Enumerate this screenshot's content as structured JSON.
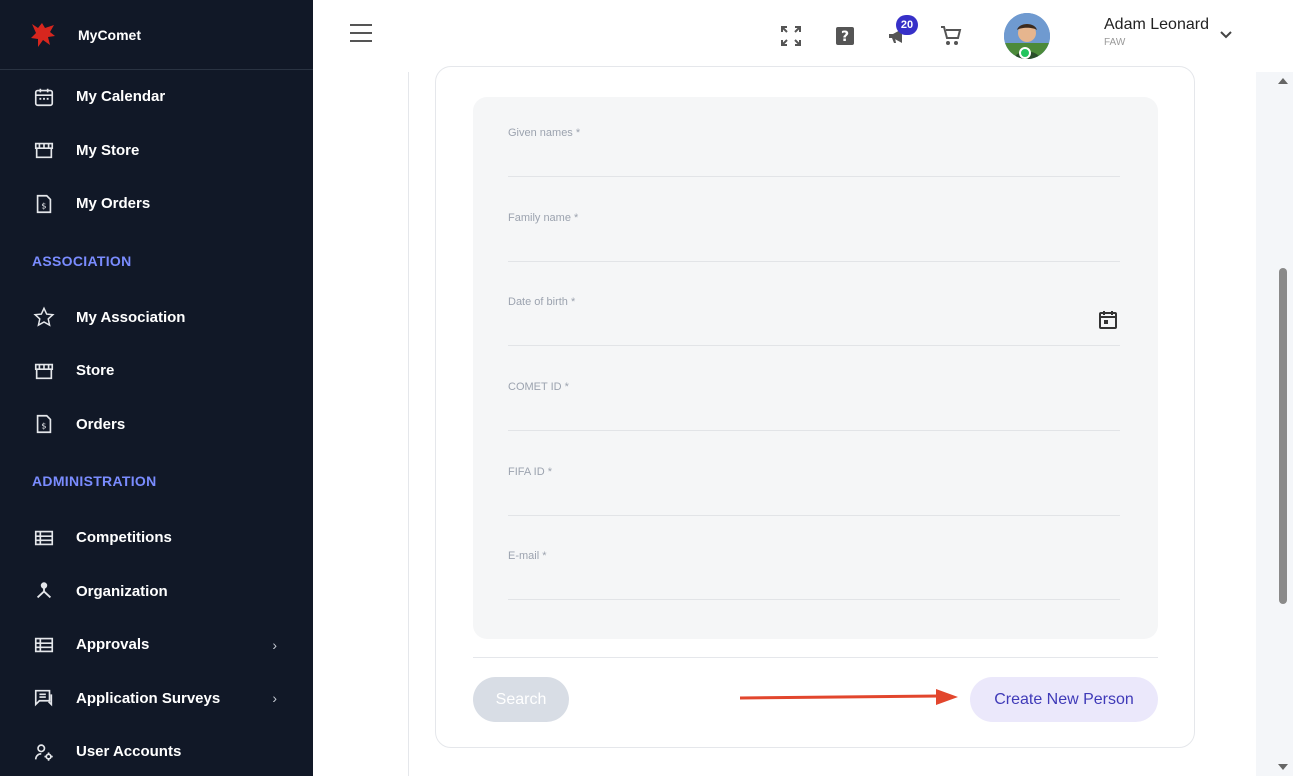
{
  "brand": {
    "name": "MyComet",
    "color": "#d7261e"
  },
  "sidebar": {
    "top_items": [
      {
        "label": "My Calendar",
        "icon": "calendar-icon"
      },
      {
        "label": "My Store",
        "icon": "store-icon"
      },
      {
        "label": "My Orders",
        "icon": "invoice-icon"
      }
    ],
    "sections": [
      {
        "title": "ASSOCIATION",
        "items": [
          {
            "label": "My Association",
            "icon": "star-icon"
          },
          {
            "label": "Store",
            "icon": "store-icon"
          },
          {
            "label": "Orders",
            "icon": "invoice-icon"
          }
        ]
      },
      {
        "title": "ADMINISTRATION",
        "items": [
          {
            "label": "Competitions",
            "icon": "list-icon"
          },
          {
            "label": "Organization",
            "icon": "hierarchy-icon"
          },
          {
            "label": "Approvals",
            "icon": "list-icon",
            "expandable": true
          },
          {
            "label": "Application Surveys",
            "icon": "chat-icon",
            "expandable": true
          },
          {
            "label": "User Accounts",
            "icon": "user-gear-icon"
          }
        ]
      }
    ],
    "accent_color": "#7a8cff"
  },
  "topbar": {
    "notifications_count": "20",
    "user": {
      "name": "Adam Leonard",
      "org": "FAW"
    }
  },
  "form": {
    "fields": [
      {
        "label": "Given names *"
      },
      {
        "label": "Family name *"
      },
      {
        "label": "Date of birth *",
        "has_calendar": true
      },
      {
        "label": "COMET ID *"
      },
      {
        "label": "FIFA ID *"
      },
      {
        "label": "E-mail *"
      }
    ],
    "search_label": "Search",
    "create_label": "Create New Person"
  }
}
